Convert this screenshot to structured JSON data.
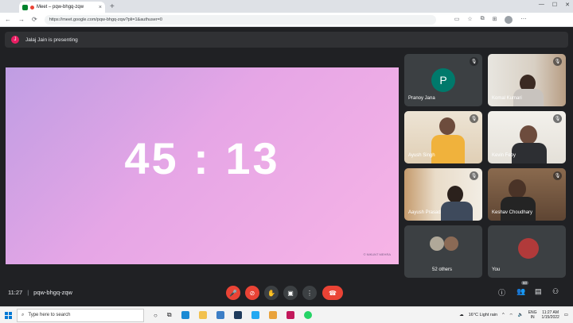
{
  "browser": {
    "tab_title": "Meet – pqw-bhgq-zqw",
    "tab_close": "×",
    "new_tab": "+",
    "url": "https://meet.google.com/pqw-bhgq-zqw?pli=1&authuser=0",
    "window_controls": [
      "—",
      "☐",
      "✕"
    ],
    "nav": {
      "back": "←",
      "forward": "→",
      "reload": "⟳"
    }
  },
  "meet": {
    "presenter": {
      "initial": "J",
      "text": "Jalaj Jain is presenting"
    },
    "presentation": {
      "text": "45 : 13",
      "watermark": "© NIKUNT MEHRA"
    },
    "tiles": [
      {
        "name": "Pranoy Jana",
        "initial": "P"
      },
      {
        "name": "Komal Kumari"
      },
      {
        "name": "Ayush Singh"
      },
      {
        "name": "Kevin Feby"
      },
      {
        "name": "Aayush Prasad"
      },
      {
        "name": "Keshav Choudhary"
      },
      {
        "name": "52 others"
      },
      {
        "name": "You"
      }
    ],
    "meeting_time": "11:27",
    "separator": "|",
    "meeting_code": "pqw-bhgq-zqw",
    "participant_badge": "60",
    "accent_red": "#ea4335"
  },
  "taskbar": {
    "search_placeholder": "Type here to search",
    "weather": "16°C  Light rain",
    "language": "ENG",
    "region": "IN",
    "time": "11:27 AM",
    "date": "1/15/2022"
  }
}
